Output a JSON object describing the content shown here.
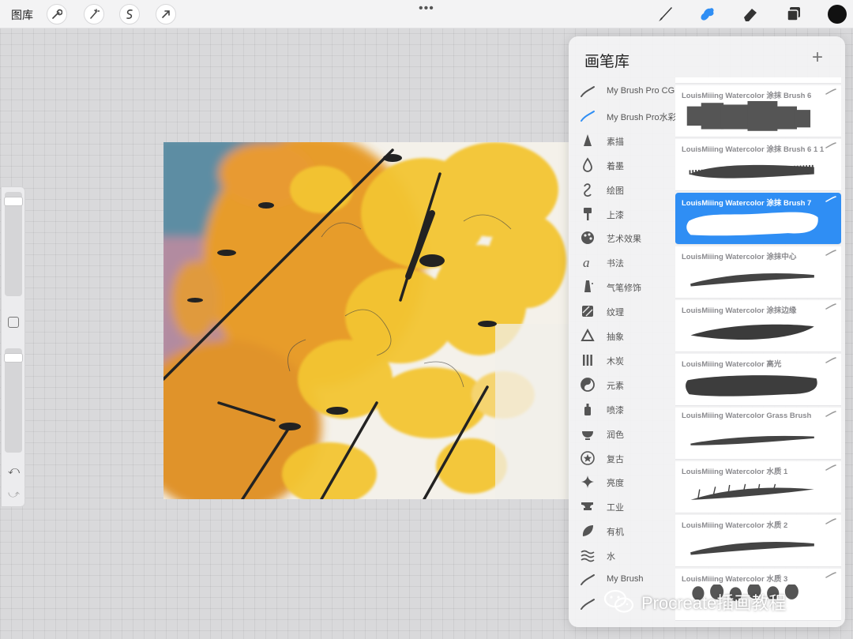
{
  "toolbar": {
    "gallery_label": "图库",
    "left_tools": [
      "wrench-icon",
      "magic-wand-icon",
      "selection-icon",
      "transform-arrow-icon"
    ],
    "right_tools": [
      "brush-icon",
      "smudge-icon",
      "eraser-icon",
      "layers-icon"
    ],
    "active_tool": "smudge-icon",
    "more_label": "•••",
    "current_color": "#111111",
    "accent": "#2f8ef4"
  },
  "sidebar": {
    "brush_size_level": 0.05,
    "opacity_level": 0.05,
    "undo": "⤺",
    "redo": "⤻"
  },
  "panel": {
    "title": "画笔库",
    "add_label": "+",
    "categories": [
      {
        "label": "My Brush Pro CG",
        "icon": "stroke-icon"
      },
      {
        "label": "My Brush Pro水彩",
        "icon": "stroke-icon",
        "active": true
      },
      {
        "label": "素描",
        "icon": "pencil-tip-icon"
      },
      {
        "label": "着墨",
        "icon": "ink-drop-icon"
      },
      {
        "label": "绘图",
        "icon": "swirl-icon"
      },
      {
        "label": "上漆",
        "icon": "paint-roller-icon"
      },
      {
        "label": "艺术效果",
        "icon": "palette-icon"
      },
      {
        "label": "书法",
        "icon": "calligraphy-icon"
      },
      {
        "label": "气笔修饰",
        "icon": "airbrush-icon"
      },
      {
        "label": "纹理",
        "icon": "texture-icon"
      },
      {
        "label": "抽象",
        "icon": "triangle-icon"
      },
      {
        "label": "木炭",
        "icon": "charcoal-icon"
      },
      {
        "label": "元素",
        "icon": "yin-yang-icon"
      },
      {
        "label": "喷漆",
        "icon": "spray-can-icon"
      },
      {
        "label": "润色",
        "icon": "bowl-icon"
      },
      {
        "label": "复古",
        "icon": "star-badge-icon"
      },
      {
        "label": "亮度",
        "icon": "sparkle-icon"
      },
      {
        "label": "工业",
        "icon": "anvil-icon"
      },
      {
        "label": "有机",
        "icon": "leaf-icon"
      },
      {
        "label": "水",
        "icon": "waves-icon"
      },
      {
        "label": "My Brush",
        "icon": "stroke-icon"
      },
      {
        "label": "",
        "icon": "stroke-icon"
      }
    ],
    "brushes": [
      {
        "name": "",
        "stroke": "dark"
      },
      {
        "name": "LouisMiiing Watercolor 涂抹 Brush 6",
        "stroke": "blocky"
      },
      {
        "name": "LouisMiiing Watercolor 涂抹 Brush 6 1 1",
        "stroke": "bristle"
      },
      {
        "name": "LouisMiiing Watercolor 涂抹 Brush 7",
        "stroke": "white-rough",
        "selected": true
      },
      {
        "name": "LouisMiiing Watercolor 涂抹中心",
        "stroke": "taper"
      },
      {
        "name": "LouisMiiing Watercolor 涂抹边缘",
        "stroke": "soft-wide"
      },
      {
        "name": "LouisMiiing Watercolor 高光",
        "stroke": "wet-wide"
      },
      {
        "name": "LouisMiiing Watercolor Grass Brush",
        "stroke": "taper-thin"
      },
      {
        "name": "LouisMiiing Watercolor 水质 1",
        "stroke": "grass"
      },
      {
        "name": "LouisMiiing Watercolor 水质 2",
        "stroke": "taper"
      },
      {
        "name": "LouisMiiing Watercolor 水质 3",
        "stroke": "dots"
      }
    ]
  },
  "watermark": {
    "text": "Procreate插画教程",
    "icon": "wechat-icon"
  }
}
